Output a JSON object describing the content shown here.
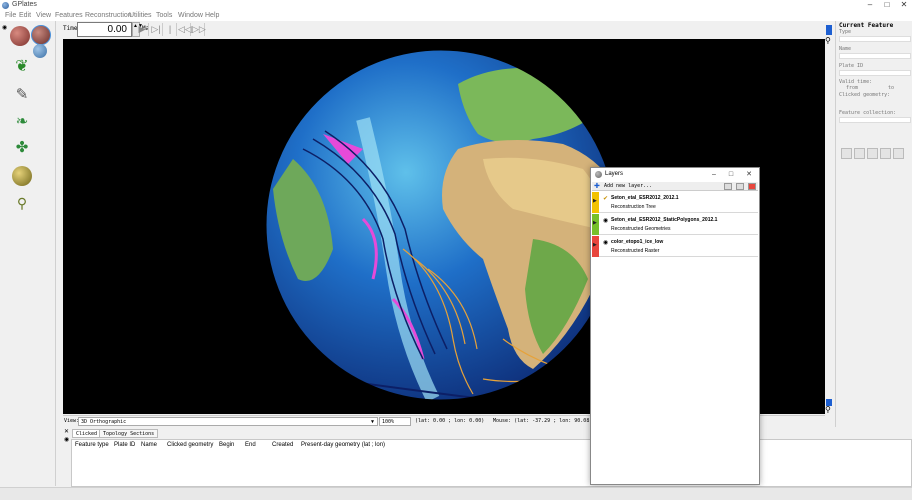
{
  "app": {
    "title": "GPlates"
  },
  "window_controls": {
    "minimize": "–",
    "maximize": "□",
    "close": "✕"
  },
  "menu": [
    "File",
    "Edit",
    "View",
    "Features",
    "Reconstruction",
    "Utilities",
    "Tools",
    "Window",
    "Help"
  ],
  "timebar": {
    "label": "Time:",
    "value": "0.00",
    "unit": "Ma",
    "spin": "▲▼",
    "buttons": [
      "▶",
      "▷|",
      "|◁◁",
      "◁◁",
      "▷▷"
    ]
  },
  "right_panel": {
    "header": "Current Feature",
    "fields": [
      "Type",
      "Name",
      "Plate ID",
      "Valid time:",
      "Clicked geometry:",
      "Feature collection:"
    ],
    "valid_from": "from",
    "valid_to": "to"
  },
  "statusbar": {
    "view_label": "View:",
    "view_value": "3D Orthographic",
    "zoom": "100%",
    "center_coords": "(lat: 0.00 ; lon: 0.00)",
    "mouse_coords": "Mouse: (lat: -37.29 ; lon: 90.08) (of"
  },
  "bottom_panel": {
    "tabs": [
      "Clicked",
      "Topology Sections"
    ],
    "columns": [
      "Feature type",
      "Plate ID",
      "Name",
      "Clicked geometry",
      "Begin",
      "End",
      "Created",
      "Present-day geometry (lat ; lon)"
    ]
  },
  "layers_window": {
    "title": "Layers",
    "add_layer": "Add new layer...",
    "layers": [
      {
        "name": "Seton_etal_ESR2012_2012.1",
        "type": "Reconstruction Tree",
        "color": "#f2c200"
      },
      {
        "name": "Seton_etal_ESR2012_StaticPolygons_2012.1",
        "type": "Reconstructed Geometries",
        "color": "#76c02a"
      },
      {
        "name": "color_etopo1_ice_low",
        "type": "Reconstructed Raster",
        "color": "#e8463d"
      }
    ]
  },
  "colors": {
    "accent": "#1d5fd1",
    "canvas_bg": "#000000"
  }
}
